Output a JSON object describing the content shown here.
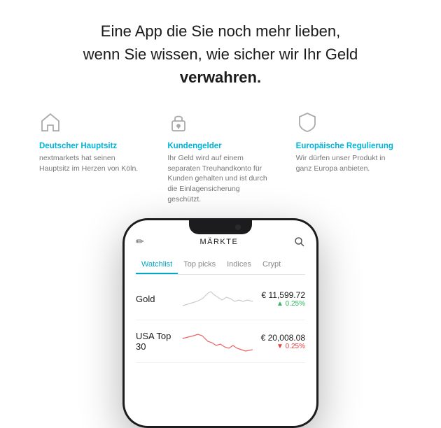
{
  "header": {
    "line1": "Eine App die Sie noch mehr lieben,",
    "line2": "wenn Sie wissen, wie sicher wir Ihr Geld",
    "line3": "verwahren."
  },
  "features": [
    {
      "id": "home",
      "icon": "home",
      "title": "Deutscher Hauptsitz",
      "desc": "nextmarkets hat seinen Hauptsitz im Herzen von Köln."
    },
    {
      "id": "lock",
      "icon": "lock",
      "title": "Kundengelder",
      "desc": "Ihr Geld wird auf einem separaten Treuhandkonto für Kunden gehalten und ist durch die Einlagensicherung geschützt."
    },
    {
      "id": "shield",
      "icon": "shield",
      "title": "Europäische Regulierung",
      "desc": "Wir dürfen unser Produkt in ganz Europa anbieten."
    }
  ],
  "phone": {
    "screen_title": "MÄRKTE",
    "tabs": [
      {
        "label": "Watchlist",
        "active": true
      },
      {
        "label": "Top picks",
        "active": false
      },
      {
        "label": "Indices",
        "active": false
      },
      {
        "label": "Crypt",
        "active": false
      }
    ],
    "stocks": [
      {
        "name": "Gold",
        "price": "€ 11,599.72",
        "change": "▲ 0.25%",
        "direction": "up"
      },
      {
        "name": "USA Top 30",
        "price": "€ 20,008.08",
        "change": "▼ 0.25%",
        "direction": "down"
      }
    ]
  }
}
